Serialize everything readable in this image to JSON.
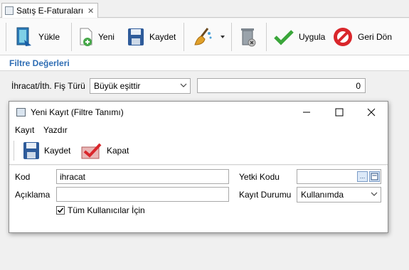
{
  "tab": {
    "title": "Satış E-Faturaları",
    "close": "✕"
  },
  "toolbar": {
    "load_label": "Yükle",
    "new_label": "Yeni",
    "save_label": "Kaydet",
    "apply_label": "Uygula",
    "back_label": "Geri Dön"
  },
  "filter": {
    "section_title": "Filtre Değerleri",
    "field_label": "İhracat/İth. Fiş Türü",
    "operator": "Büyük eşittir",
    "value": "0"
  },
  "dialog": {
    "title": "Yeni Kayıt (Filtre Tanımı)",
    "menu": [
      "Kayıt",
      "Yazdır"
    ],
    "toolbar": {
      "save_label": "Kaydet",
      "close_label": "Kapat"
    },
    "form": {
      "code_label": "Kod",
      "code_value": "ihracat",
      "description_label": "Açıklama",
      "description_value": "",
      "all_users_label": "Tüm Kullanıcılar İçin",
      "all_users_checked": true,
      "auth_code_label": "Yetki Kodu",
      "auth_code_value": "",
      "status_label": "Kayıt Durumu",
      "status_value": "Kullanımda"
    }
  },
  "colors": {
    "accent": "#2e6db4",
    "apply_green": "#3aa63a",
    "back_red": "#d9262b"
  }
}
